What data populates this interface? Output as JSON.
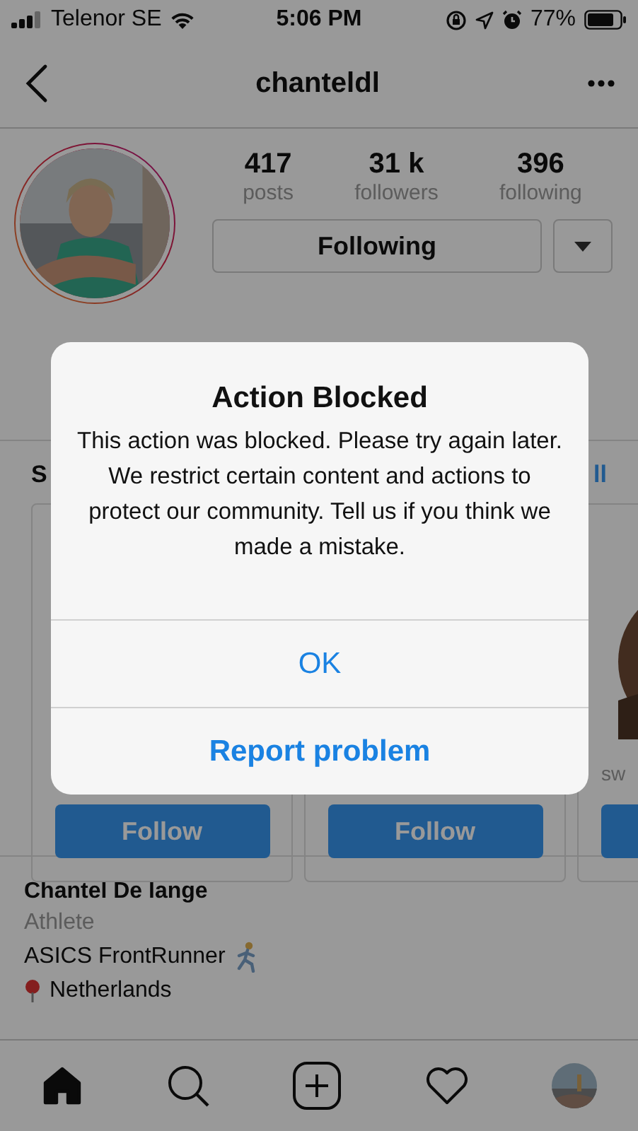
{
  "status_bar": {
    "carrier": "Telenor SE",
    "time": "5:06 PM",
    "battery": "77%"
  },
  "nav": {
    "title": "chanteldl"
  },
  "profile": {
    "stats": [
      {
        "value": "417",
        "label": "posts"
      },
      {
        "value": "31 k",
        "label": "followers"
      },
      {
        "value": "396",
        "label": "following"
      }
    ],
    "follow_button": "Following"
  },
  "suggestions": {
    "heading": "S",
    "see_all": "ll",
    "cards": [
      {
        "button": "Follow"
      },
      {
        "button": "Follow"
      },
      {
        "caption": "sw"
      }
    ]
  },
  "bio": {
    "name": "Chantel De lange",
    "category": "Athlete",
    "lines": [
      {
        "kind": "headline",
        "text": "ASICS FrontRunner"
      },
      {
        "kind": "location",
        "text": "Netherlands"
      }
    ]
  },
  "dialog": {
    "title": "Action Blocked",
    "message": "This action was blocked. Please try again later. We restrict certain content and actions to protect our community. Tell us if you think we made a mistake.",
    "buttons": [
      {
        "label": "OK",
        "kind": "plain"
      },
      {
        "label": "Report problem",
        "kind": "strong"
      }
    ]
  },
  "tab_bar": {
    "tabs": [
      {
        "kind": "home",
        "selected": true
      },
      {
        "kind": "search",
        "selected": false
      },
      {
        "kind": "add",
        "selected": false
      },
      {
        "kind": "activity",
        "selected": false
      },
      {
        "kind": "profile",
        "selected": false
      }
    ]
  }
}
